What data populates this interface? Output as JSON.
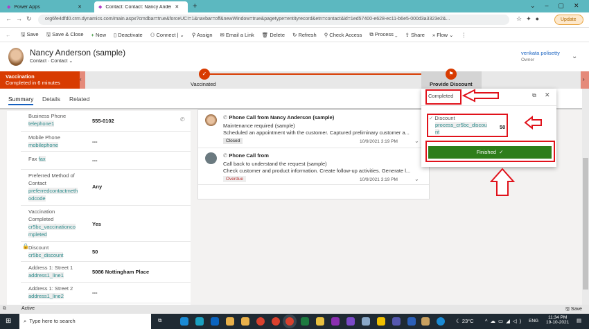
{
  "browser": {
    "tabs": [
      {
        "label": "Power Apps"
      },
      {
        "label": "Contact: Contact: Nancy Anderso"
      }
    ],
    "new_tab": "+",
    "url": "org6fe4dfd0.crm.dynamics.com/main.aspx?cmdbar=true&forceUCI=1&navbar=off&newWindow=true&pagetype=entityrecord&etn=contact&id=1ed57400-e628-ec11-b6e5-000d3a3323e2&...",
    "update": "Update"
  },
  "commands": [
    "Save",
    "Save & Close",
    "New",
    "Deactivate",
    "Connect",
    "Assign",
    "Email a Link",
    "Delete",
    "Refresh",
    "Check Access",
    "Process",
    "Share",
    "Flow"
  ],
  "record": {
    "name": "Nancy Anderson (sample)",
    "entity": "Contact",
    "form": "Contact",
    "owner_name": "venkata polisetty",
    "owner_label": "Owner"
  },
  "bpf": {
    "active_stage": "Vaccination",
    "active_status": "Completed in 6 minutes",
    "stages": [
      "Vaccinated",
      "Provide Discount"
    ],
    "color": "#d83b01"
  },
  "form_tabs": [
    "Summary",
    "Details",
    "Related"
  ],
  "fields": [
    {
      "label": "Business Phone",
      "logical": "telephone1",
      "value": "555-0102"
    },
    {
      "label": "Mobile Phone",
      "logical": "mobilephone",
      "value": "---"
    },
    {
      "label": "Fax",
      "logical": "fax",
      "value": "---"
    },
    {
      "label": "Preferred Method of Contact",
      "logical": "preferredcontactmethodcode",
      "value": "Any"
    },
    {
      "label": "Vaccination Completed",
      "logical": "cr5bc_vaccinationcompleted",
      "value": "Yes"
    },
    {
      "label": "Discount",
      "logical": "cr5bc_discount",
      "value": "50"
    },
    {
      "label": "Address 1: Street 1",
      "logical": "address1_line1",
      "value": "5086 Nottingham Place"
    },
    {
      "label": "Address 1: Street 2",
      "logical": "address1_line2",
      "value": "---"
    }
  ],
  "activities": [
    {
      "title": "Phone Call from Nancy Anderson (sample)",
      "subject": "Maintenance required (sample)",
      "desc": "Scheduled an appointment with the customer. Captured preliminary customer a...",
      "status": "Closed",
      "date": "10/9/2021 3:19 PM"
    },
    {
      "title": "Phone Call from",
      "subject": "Call back to understand the request (sample)",
      "desc": "Check customer and product information. Create follow-up activities. Generate l...",
      "status": "Overdue",
      "date": "10/9/2021 3:19 PM"
    }
  ],
  "flyout": {
    "status": "Completed",
    "field_label": "Discount",
    "field_logical": "process_cr5bc_discount",
    "field_value": "50",
    "button": "Finished",
    "button_color": "#2e7d1a"
  },
  "statusbar": {
    "state": "Active",
    "save": "Save"
  },
  "taskbar": {
    "search": "Type here to search",
    "weather": "23°C",
    "lang": "ENG",
    "time": "11:34 PM",
    "date": "19-10-2021"
  }
}
